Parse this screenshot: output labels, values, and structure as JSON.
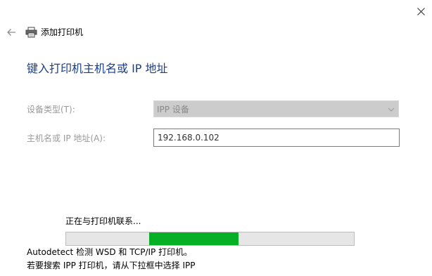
{
  "header": {
    "title": "添加打印机"
  },
  "page": {
    "heading": "键入打印机主机名或 IP 地址"
  },
  "form": {
    "device_type_label": "设备类型(T):",
    "device_type_value": "IPP 设备",
    "host_label": "主机名或 IP 地址(A):",
    "host_value": "192.168.0.102"
  },
  "status": {
    "text": "正在与打印机联系...",
    "progress": "indeterminate"
  },
  "info": {
    "line1": "Autodetect 检测 WSD 和 TCP/IP 打印机。",
    "line2": "若要搜索 IPP 打印机，请从下拉框中选择 IPP"
  },
  "colors": {
    "heading": "#1a3e8c",
    "progress_fill": "#06b025",
    "disabled_text": "#9a9a9a"
  },
  "icons": {
    "close": "close-icon",
    "back": "back-arrow-icon",
    "printer": "printer-icon",
    "dropdown": "chevron-down-icon"
  }
}
